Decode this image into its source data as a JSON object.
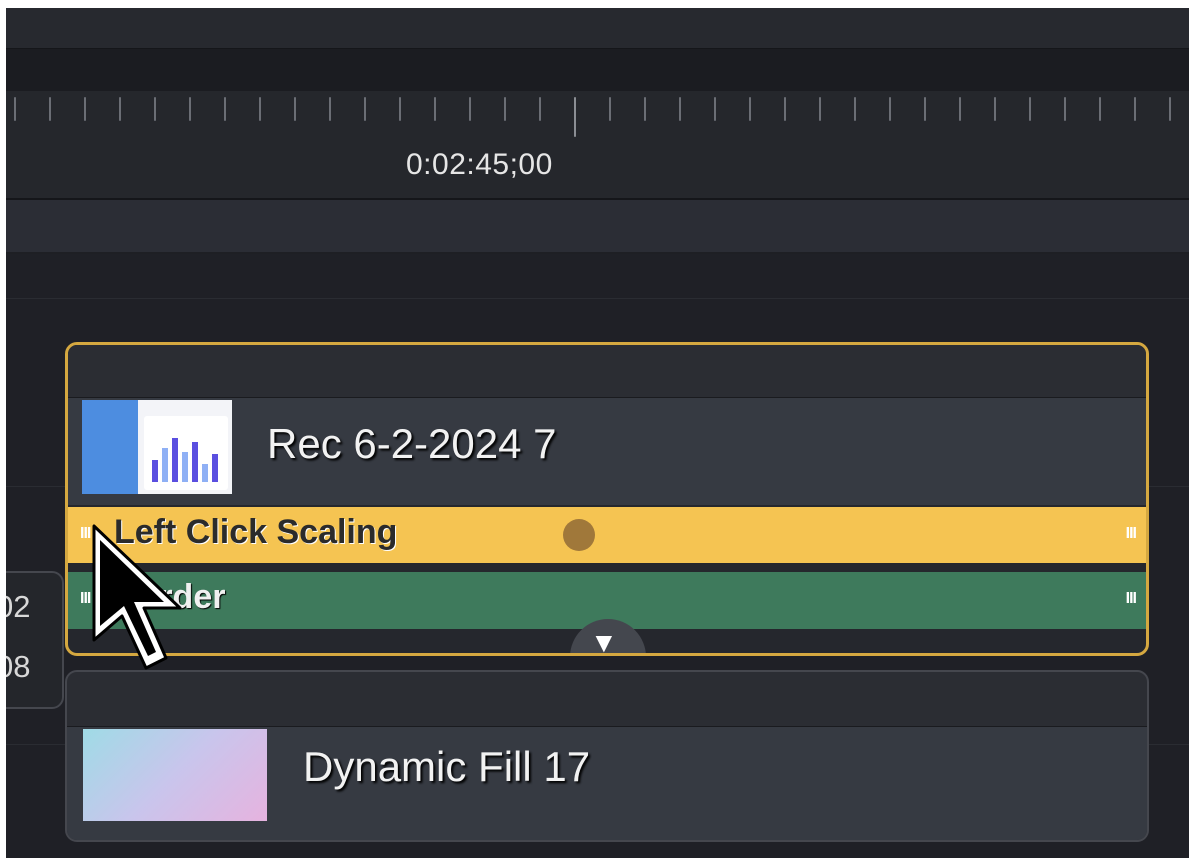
{
  "timeline": {
    "timecode": "0:02:45;00"
  },
  "left_tab": {
    "line1": "02",
    "line2": "08"
  },
  "clips": [
    {
      "title": "Rec 6-2-2024 7",
      "selected": true,
      "effects": [
        {
          "label": "Left Click Scaling",
          "color": "#f5c452"
        },
        {
          "label": "Border",
          "color": "#3e7a5c"
        }
      ]
    },
    {
      "title": "Dynamic Fill 17",
      "selected": false
    }
  ],
  "icons": {
    "expand": "triangle-down-icon",
    "grip": "grip-handle-icon",
    "cursor": "mouse-pointer-icon"
  },
  "colors": {
    "selection_border": "#d5a840",
    "background": "#1e1f24"
  }
}
